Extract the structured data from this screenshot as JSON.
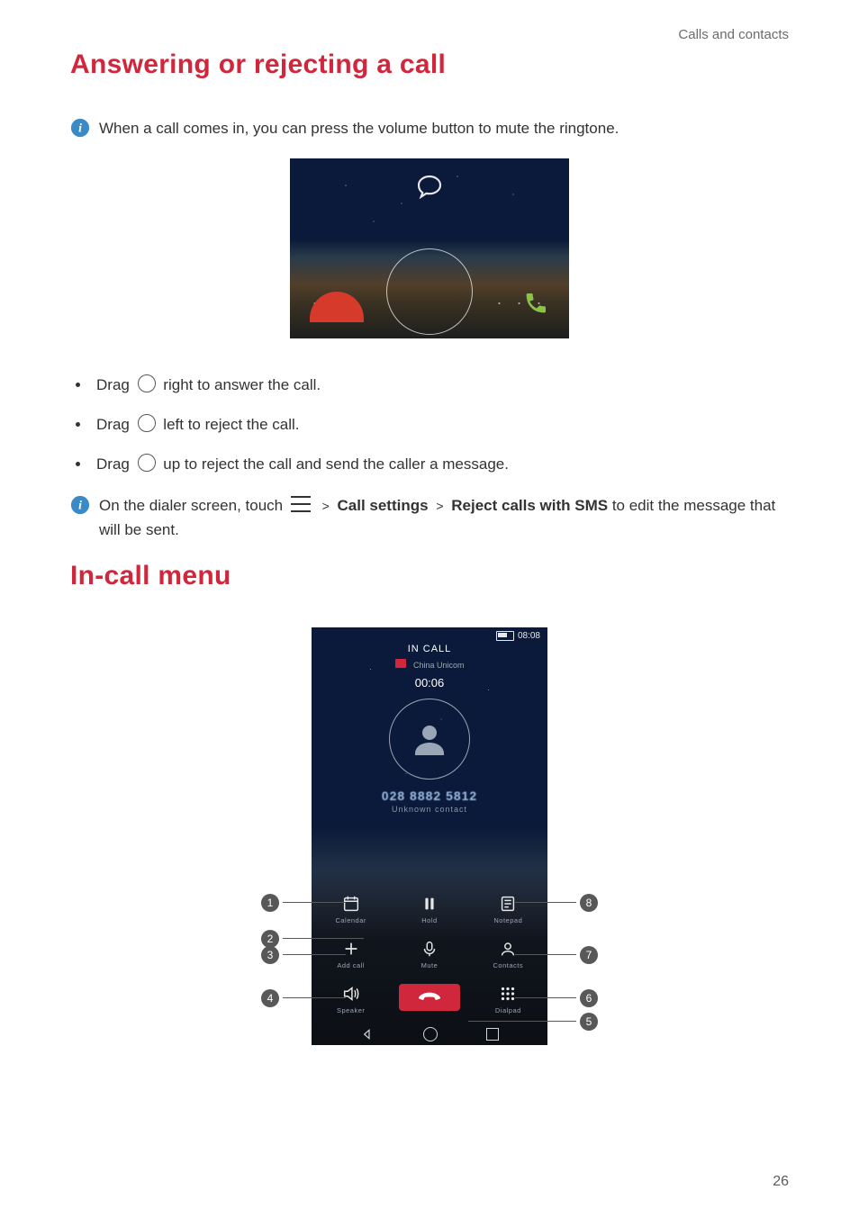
{
  "runningHeader": "Calls and contacts",
  "section1_title": "Answering or rejecting a call",
  "info1_text": "When a call comes in, you can press the volume button to mute the ringtone.",
  "bullets": [
    {
      "pre": "Drag ",
      "post": " right to answer the call."
    },
    {
      "pre": "Drag ",
      "post": " left to reject the call."
    },
    {
      "pre": "Drag ",
      "post": " up to reject the call and send the caller a message."
    }
  ],
  "info2": {
    "pre": "On the dialer screen, touch ",
    "gt": ">",
    "bold1": "Call settings",
    "bold2": "Reject calls with SMS",
    "post": " to edit the message that will be sent."
  },
  "section2_title": "In-call menu",
  "phone": {
    "statusTime": "08:08",
    "inCall": "IN CALL",
    "carrier": "China Unicom",
    "duration": "00:06",
    "number": "028 8882 5812",
    "contactType": "Unknown contact",
    "labels": {
      "calendar": "Calendar",
      "hold": "Hold",
      "notepad": "Notepad",
      "addcall": "Add call",
      "mute": "Mute",
      "contacts": "Contacts",
      "speaker": "Speaker",
      "dialpad": "Dialpad"
    }
  },
  "callouts": {
    "c1": "1",
    "c2": "2",
    "c3": "3",
    "c4": "4",
    "c5": "5",
    "c6": "6",
    "c7": "7",
    "c8": "8"
  },
  "pageNumber": "26"
}
